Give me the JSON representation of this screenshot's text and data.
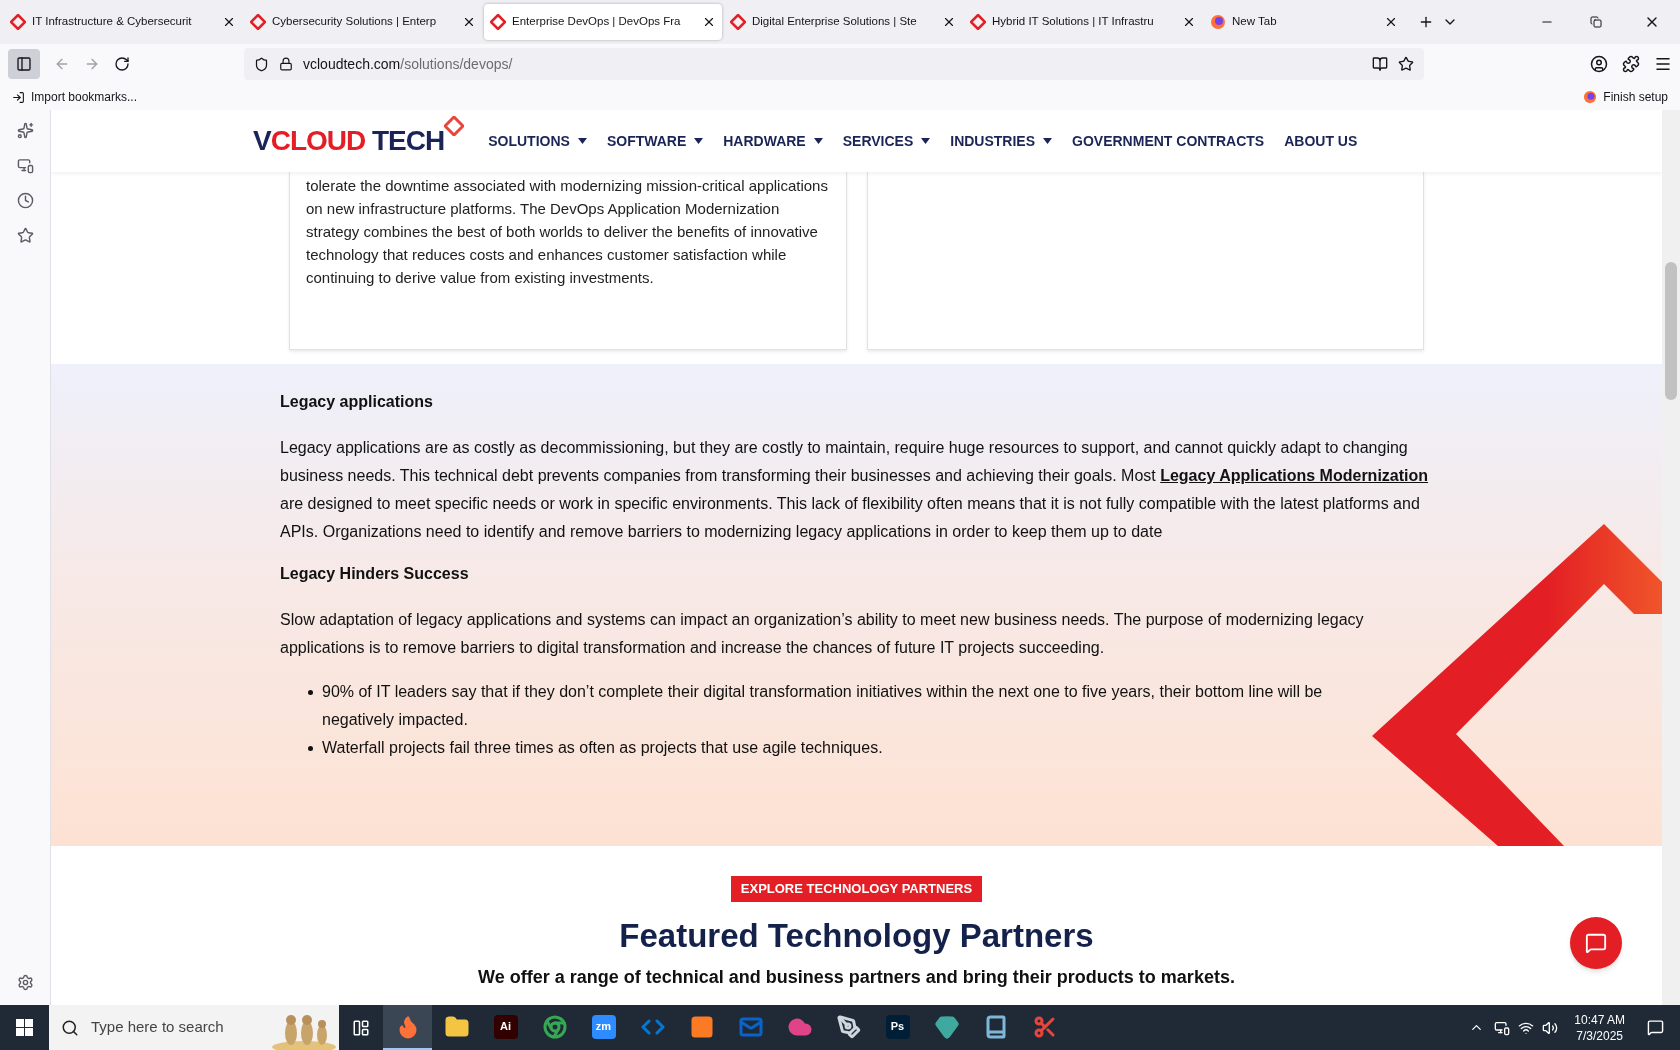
{
  "browser": {
    "tabs": [
      {
        "title": "IT Infrastructure & Cybersecurit",
        "kind": "site",
        "selected": false
      },
      {
        "title": "Cybersecurity Solutions | Enterp",
        "kind": "site",
        "selected": false
      },
      {
        "title": "Enterprise DevOps | DevOps Fra",
        "kind": "site",
        "selected": true
      },
      {
        "title": "Digital Enterprise Solutions | Ste",
        "kind": "site",
        "selected": false
      },
      {
        "title": "Hybrid IT Solutions | IT Infrastru",
        "kind": "site",
        "selected": false
      },
      {
        "title": "New Tab",
        "kind": "newtab",
        "selected": false
      }
    ],
    "url": {
      "host": "vcloudtech.com",
      "path": "/solutions/devops/"
    },
    "bookmarks": {
      "import": "Import bookmarks...",
      "finish": "Finish setup"
    }
  },
  "header": {
    "logo": {
      "first": "V",
      "middle": "CLOUD",
      "last": " TECH"
    },
    "nav": [
      {
        "label": "SOLUTIONS",
        "has_menu": true
      },
      {
        "label": "SOFTWARE",
        "has_menu": true
      },
      {
        "label": "HARDWARE",
        "has_menu": true
      },
      {
        "label": "SERVICES",
        "has_menu": true
      },
      {
        "label": "INDUSTRIES",
        "has_menu": true
      },
      {
        "label": "GOVERNMENT CONTRACTS",
        "has_menu": false
      },
      {
        "label": "ABOUT US",
        "has_menu": false
      }
    ]
  },
  "card_text": "tolerate the downtime associated with modernizing mission-critical applications on new infrastructure platforms. The DevOps Application Modernization strategy combines the best of both worlds to deliver the benefits of innovative technology that reduces costs and enhances customer satisfaction while continuing to derive value from existing investments.",
  "legacy": {
    "heading": "Legacy applications",
    "paragraph": {
      "before": "Legacy applications are as costly as decommissioning, but they are costly to maintain, require huge resources to support, and cannot quickly adapt to changing business needs. This technical debt prevents companies from transforming their businesses and achieving their goals. Most ",
      "link": "Legacy Applications Modernization",
      "after": " are designed to meet specific needs or work in specific environments. This lack of flexibility often means that it is not fully compatible with the latest platforms and APIs. Organizations need to identify and remove barriers to modernizing legacy applications in order to keep them up to date"
    },
    "heading2": "Legacy Hinders Success",
    "paragraph2": "Slow adaptation of legacy applications and systems can impact an organization’s ability to meet new business needs. The purpose of modernizing legacy applications is to remove barriers to digital transformation and increase the chances of future IT projects succeeding.",
    "bullets": [
      "90% of IT leaders say that if they don’t complete their digital transformation initiatives within the next one to five years, their bottom line will be negatively impacted.",
      "Waterfall projects fail three times as often as projects that use agile techniques."
    ]
  },
  "partners": {
    "badge": "EXPLORE TECHNOLOGY PARTNERS",
    "title": "Featured Technology Partners",
    "subtitle": "We offer a range of technical and business partners and bring their products to markets."
  },
  "taskbar": {
    "search_placeholder": "Type here to search",
    "apps": [
      {
        "kind": "firefox",
        "color": "#ff7139",
        "selected": true
      },
      {
        "kind": "folder",
        "color": "#f4c542",
        "selected": false
      },
      {
        "kind": "text",
        "label": "Ai",
        "color": "#330000",
        "selected": false
      },
      {
        "kind": "chrome",
        "color": "#34a853",
        "selected": false
      },
      {
        "kind": "text",
        "label": "zm",
        "color": "#2d8cff",
        "selected": false
      },
      {
        "kind": "code",
        "color": "#0078d4",
        "selected": false
      },
      {
        "kind": "xampp",
        "color": "#fb7a24",
        "selected": false
      },
      {
        "kind": "outlook",
        "color": "#0a64c8",
        "selected": false
      },
      {
        "kind": "cloud",
        "color": "#e0438a",
        "selected": false
      },
      {
        "kind": "pen",
        "color": "#cfd6de",
        "selected": false
      },
      {
        "kind": "text",
        "label": "Ps",
        "color": "#001e36",
        "selected": false
      },
      {
        "kind": "gem",
        "color": "#3fa9a0",
        "selected": false
      },
      {
        "kind": "book",
        "color": "#7fb7d9",
        "selected": false
      },
      {
        "kind": "snip",
        "color": "#e8453c",
        "selected": false
      }
    ],
    "time": "10:47 AM",
    "date": "7/3/2025"
  }
}
